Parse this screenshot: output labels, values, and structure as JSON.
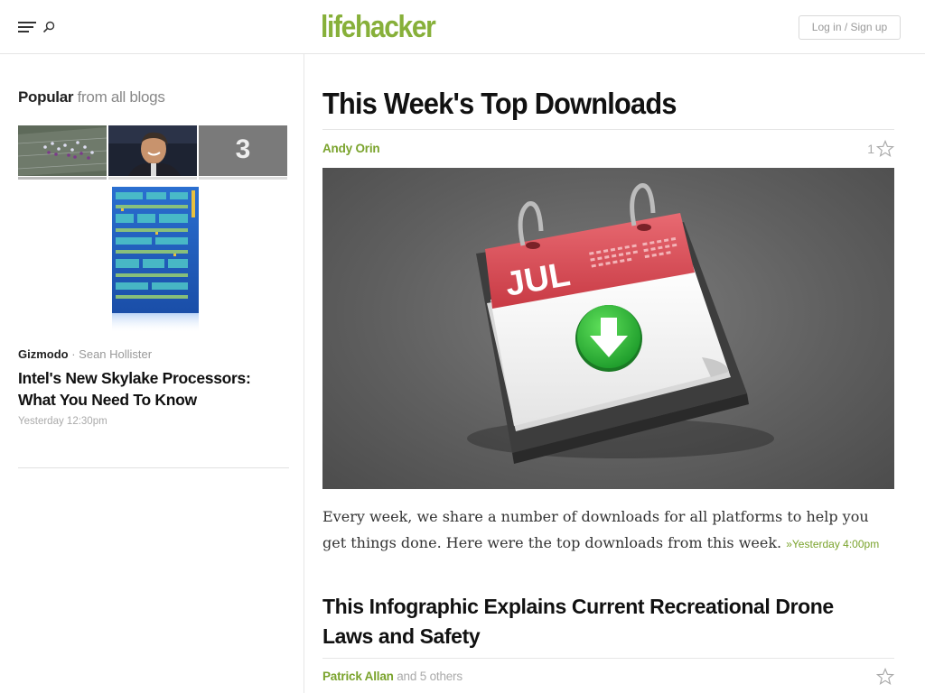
{
  "header": {
    "logo_left": "life",
    "logo_right": "hacker",
    "login_label": "Log in / Sign up",
    "brand_color": "#87b03a"
  },
  "sidebar": {
    "heading_bold": "Popular",
    "heading_light": "from all blogs",
    "thumb_number": "3",
    "story": {
      "blog": "Gizmodo",
      "separator": " · ",
      "author": "Sean Hollister",
      "title": "Intel's New Skylake Processors: What You Need To Know",
      "time": "Yesterday 12:30pm"
    }
  },
  "main": {
    "article1": {
      "title": "This Week's Top Downloads",
      "author": "Andy Orin",
      "likes": "1",
      "hero_month": "JUL",
      "excerpt": "Every week, we share a number of downloads for all platforms to help you get things done. Here were the top downloads from this week.",
      "time": "»Yesterday 4:00pm"
    },
    "article2": {
      "title": "This Infographic Explains Current Recreational Drone Laws and Safety",
      "author": "Patrick Allan",
      "others": "and 5 others"
    }
  }
}
